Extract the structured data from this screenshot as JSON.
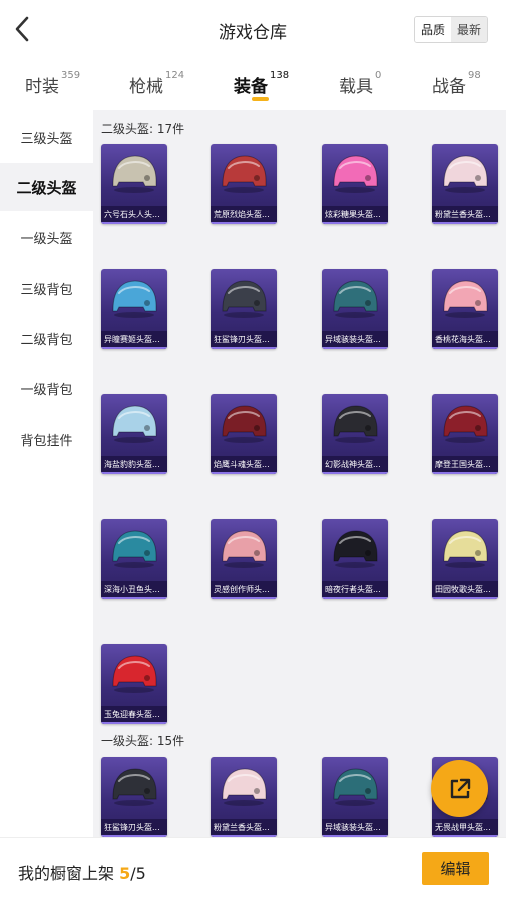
{
  "header": {
    "title": "游戏仓库",
    "sort_quality": "品质",
    "sort_newest": "最新"
  },
  "tabs": [
    {
      "label": "时装",
      "count": "359"
    },
    {
      "label": "枪械",
      "count": "124"
    },
    {
      "label": "装备",
      "count": "138"
    },
    {
      "label": "载具",
      "count": "0"
    },
    {
      "label": "战备",
      "count": "98"
    }
  ],
  "sidebar": [
    {
      "label": "三级头盔"
    },
    {
      "label": "二级头盔"
    },
    {
      "label": "一级头盔"
    },
    {
      "label": "三级背包"
    },
    {
      "label": "二级背包"
    },
    {
      "label": "一级背包"
    },
    {
      "label": "背包挂件"
    }
  ],
  "sections": [
    {
      "title": "二级头盔: 17件"
    },
    {
      "title": "一级头盔: 15件"
    }
  ],
  "items_level2": [
    {
      "name": "六号石头人头...",
      "color": "#c8c2b0",
      "icon": "helmet-rock-icon"
    },
    {
      "name": "荒原烈焰头盔...",
      "color": "#b83a3a",
      "icon": "helmet-flame-icon"
    },
    {
      "name": "炫彩糖果头盔...",
      "color": "#f26bb7",
      "icon": "helmet-candy-icon"
    },
    {
      "name": "粉黛兰香头盔...",
      "color": "#f0d6dc",
      "icon": "helmet-pink-icon"
    },
    {
      "name": "异瞳赛姬头盔...",
      "color": "#4aa6d8",
      "icon": "helmet-cat-icon"
    },
    {
      "name": "狂鲨锋刃头盔...",
      "color": "#3b3f4a",
      "icon": "helmet-shark-icon"
    },
    {
      "name": "异域骇装头盔...",
      "color": "#2f6f7a",
      "icon": "helmet-alien-icon"
    },
    {
      "name": "香桃花海头盔...",
      "color": "#f2a6b4",
      "icon": "helmet-peach-icon"
    },
    {
      "name": "海盐豹豹头盔...",
      "color": "#a9d2e8",
      "icon": "helmet-leopard-icon"
    },
    {
      "name": "焰鹰斗魂头盔...",
      "color": "#7a1e26",
      "icon": "helmet-hawk-icon"
    },
    {
      "name": "幻影战神头盔...",
      "color": "#2a2a30",
      "icon": "helmet-phantom-icon"
    },
    {
      "name": "摩登王国头盔...",
      "color": "#8c1f2a",
      "icon": "helmet-modern-icon"
    },
    {
      "name": "深海小丑鱼头...",
      "color": "#2a8aa0",
      "icon": "helmet-clownfish-icon"
    },
    {
      "name": "灵感创作师头...",
      "color": "#e8a0a8",
      "icon": "helmet-artist-icon"
    },
    {
      "name": "暗夜行者头盔...",
      "color": "#1c1c24",
      "icon": "helmet-night-icon"
    },
    {
      "name": "田园牧歌头盔...",
      "color": "#e6dd9a",
      "icon": "helmet-pastoral-icon"
    },
    {
      "name": "玉兔迎春头盔...",
      "color": "#d8262e",
      "icon": "helmet-rabbit-icon"
    }
  ],
  "items_level1": [
    {
      "name": "狂鲨锋刃头盔...",
      "color": "#2e3038",
      "icon": "helmet-shark-icon"
    },
    {
      "name": "粉黛兰香头盔...",
      "color": "#f0d4d8",
      "icon": "helmet-pink-icon"
    },
    {
      "name": "异域骇装头盔...",
      "color": "#2c6e78",
      "icon": "helmet-alien-icon"
    },
    {
      "name": "无畏战甲头盔...",
      "color": "#2a2a30",
      "icon": "helmet-armor-icon"
    }
  ],
  "bottom": {
    "shelf_label": "我的橱窗上架",
    "shelf_current": "5",
    "shelf_total": "/5",
    "edit_label": "编辑"
  },
  "colors": {
    "accent": "#f5a817",
    "card_bg": "#3a2b78",
    "content_bg": "#f2f2f4"
  }
}
